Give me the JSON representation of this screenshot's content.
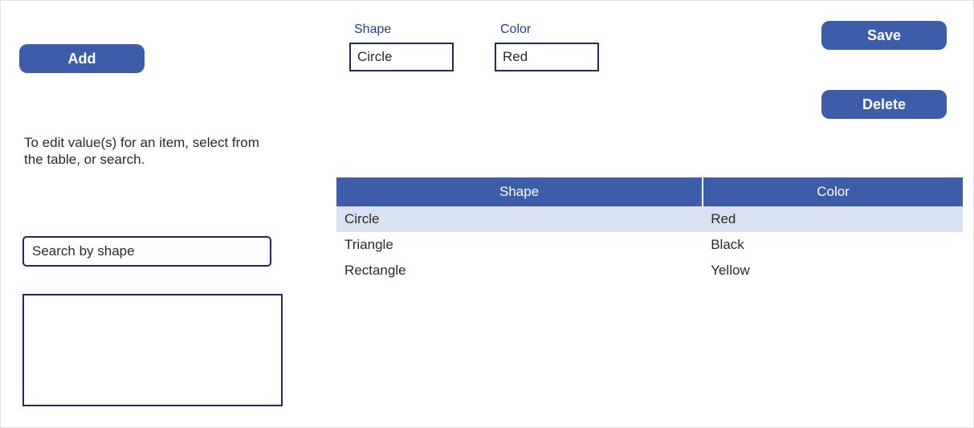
{
  "buttons": {
    "add": "Add",
    "save": "Save",
    "delete": "Delete"
  },
  "help_text": "To edit value(s) for an item, select from the table, or search.",
  "fields": {
    "shape": {
      "label": "Shape",
      "value": "Circle"
    },
    "color": {
      "label": "Color",
      "value": "Red"
    }
  },
  "search": {
    "placeholder": "Search by shape"
  },
  "table": {
    "headers": {
      "shape": "Shape",
      "color": "Color"
    },
    "rows": [
      {
        "shape": "Circle",
        "color": "Red",
        "selected": true
      },
      {
        "shape": "Triangle",
        "color": "Black",
        "selected": false
      },
      {
        "shape": "Rectangle",
        "color": "Yellow",
        "selected": false
      }
    ]
  }
}
